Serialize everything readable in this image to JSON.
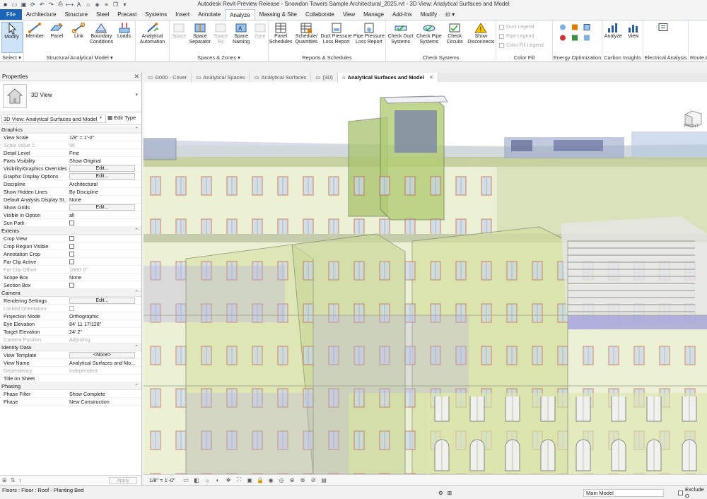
{
  "app_title": "Autodesk Revit Preview Release - Snowdon Towers Sample Architectural_2025.rvt - 3D View: Analytical Surfaces and Model",
  "menu_tabs": [
    {
      "label": "File",
      "kind": "file"
    },
    {
      "label": "Architecture"
    },
    {
      "label": "Structure"
    },
    {
      "label": "Steel"
    },
    {
      "label": "Precast"
    },
    {
      "label": "Systems"
    },
    {
      "label": "Insert"
    },
    {
      "label": "Annotate"
    },
    {
      "label": "Analyze",
      "kind": "active"
    },
    {
      "label": "Massing & Site"
    },
    {
      "label": "Collaborate"
    },
    {
      "label": "View"
    },
    {
      "label": "Manage"
    },
    {
      "label": "Add-Ins"
    },
    {
      "label": "Modify"
    }
  ],
  "ribbon": {
    "select": {
      "modify": "Modify",
      "label": "Select"
    },
    "structural": {
      "member": "Member",
      "panel": "Panel",
      "link": "Link",
      "boundary": "Boundary Conditions",
      "loads": "Loads",
      "label": "Structural Analytical Model"
    },
    "analytical_automation": "Analytical Automation",
    "spaces": {
      "space": "Space",
      "separator": "Space Separator",
      "tag_by": "Space By",
      "naming": "Space Naming",
      "zone": "Zone",
      "label": "Spaces & Zones"
    },
    "reports": {
      "panel_schedules": "Panel Schedules",
      "schedule": "Schedule/ Quantities",
      "duct_loss": "Duct Pressure Loss Report",
      "pipe_loss": "Pipe Pressure Loss Report",
      "label": "Reports & Schedules"
    },
    "check": {
      "duct": "Check Duct Systems",
      "pipe": "Check Pipe Systems",
      "circuits": "Check Circuits",
      "disconnects": "Show Disconnects",
      "label": "Check Systems"
    },
    "color_fill": {
      "duct_legend": "Duct Legend",
      "pipe_legend": "Pipe Legend",
      "cf_legend": "Color Fill Legend",
      "label": "Color Fill"
    },
    "energy_label": "Energy Optimization",
    "carbon": {
      "analyze": "Analyze",
      "view": "View",
      "label": "Carbon Insights"
    },
    "electrical_label": "Electrical Analysis",
    "route_label": "Route A"
  },
  "properties": {
    "title": "Properties",
    "type_name": "3D View",
    "instance": "3D View: Analytical Surfaces and Model",
    "edit_type": "Edit Type",
    "sections": [
      {
        "name": "Graphics",
        "rows": [
          {
            "name": "View Scale",
            "value": "1/8\" = 1'-0\""
          },
          {
            "name": "Scale Value    1:",
            "value": "96",
            "dim": true
          },
          {
            "name": "Detail Level",
            "value": "Fine"
          },
          {
            "name": "Parts Visibility",
            "value": "Show Original"
          },
          {
            "name": "Visibility/Graphics Overrides",
            "value": "Edit...",
            "button": true
          },
          {
            "name": "Graphic Display Options",
            "value": "Edit...",
            "button": true
          },
          {
            "name": "Discipline",
            "value": "Architectural"
          },
          {
            "name": "Show Hidden Lines",
            "value": "By Discipline"
          },
          {
            "name": "Default Analysis Display St...",
            "value": "None"
          },
          {
            "name": "Show Grids",
            "value": "Edit...",
            "button": true
          },
          {
            "name": "Visible In Option",
            "value": "all"
          },
          {
            "name": "Sun Path",
            "value": "",
            "checkbox": true
          }
        ]
      },
      {
        "name": "Extents",
        "rows": [
          {
            "name": "Crop View",
            "value": "",
            "checkbox": true
          },
          {
            "name": "Crop Region Visible",
            "value": "",
            "checkbox": true
          },
          {
            "name": "Annotation Crop",
            "value": "",
            "checkbox": true
          },
          {
            "name": "Far Clip Active",
            "value": "",
            "checkbox": true
          },
          {
            "name": "Far Clip Offset",
            "value": "1000'  0\"",
            "dim": true
          },
          {
            "name": "Scope Box",
            "value": "None"
          },
          {
            "name": "Section Box",
            "value": "",
            "checkbox": true
          }
        ]
      },
      {
        "name": "Camera",
        "rows": [
          {
            "name": "Rendering Settings",
            "value": "Edit...",
            "button": true
          },
          {
            "name": "Locked Orientation",
            "value": "",
            "checkbox": true,
            "dim": true
          },
          {
            "name": "Projection Mode",
            "value": "Orthographic"
          },
          {
            "name": "Eye Elevation",
            "value": "84'  11 17/128\""
          },
          {
            "name": "Target Elevation",
            "value": "24'  2\""
          },
          {
            "name": "Camera Position",
            "value": "Adjusting",
            "dim": true
          }
        ]
      },
      {
        "name": "Identity Data",
        "rows": [
          {
            "name": "View Template",
            "value": "<None>",
            "button": true
          },
          {
            "name": "View Name",
            "value": "Analytical Surfaces and Mo..."
          },
          {
            "name": "Dependency",
            "value": "Independent",
            "dim": true
          },
          {
            "name": "Title on Sheet",
            "value": ""
          }
        ]
      },
      {
        "name": "Phasing",
        "rows": [
          {
            "name": "Phase Filter",
            "value": "Show Complete"
          },
          {
            "name": "Phase",
            "value": "New Construction"
          }
        ]
      }
    ],
    "apply": "Apply"
  },
  "doc_tabs": [
    {
      "label": "G000 - Cover"
    },
    {
      "label": "Analytical Spaces"
    },
    {
      "label": "Analytical Surfaces"
    },
    {
      "label": "{3D}"
    },
    {
      "label": "Analytical Surfaces and Model",
      "active": true
    }
  ],
  "viewcube_label": "FRONT",
  "view_scale": "1/8\" = 1'-0\"",
  "status": {
    "text": "Floors : Floor : Roof - Planting Bed",
    "model": "Main Model",
    "exclude": "Exclude O"
  }
}
